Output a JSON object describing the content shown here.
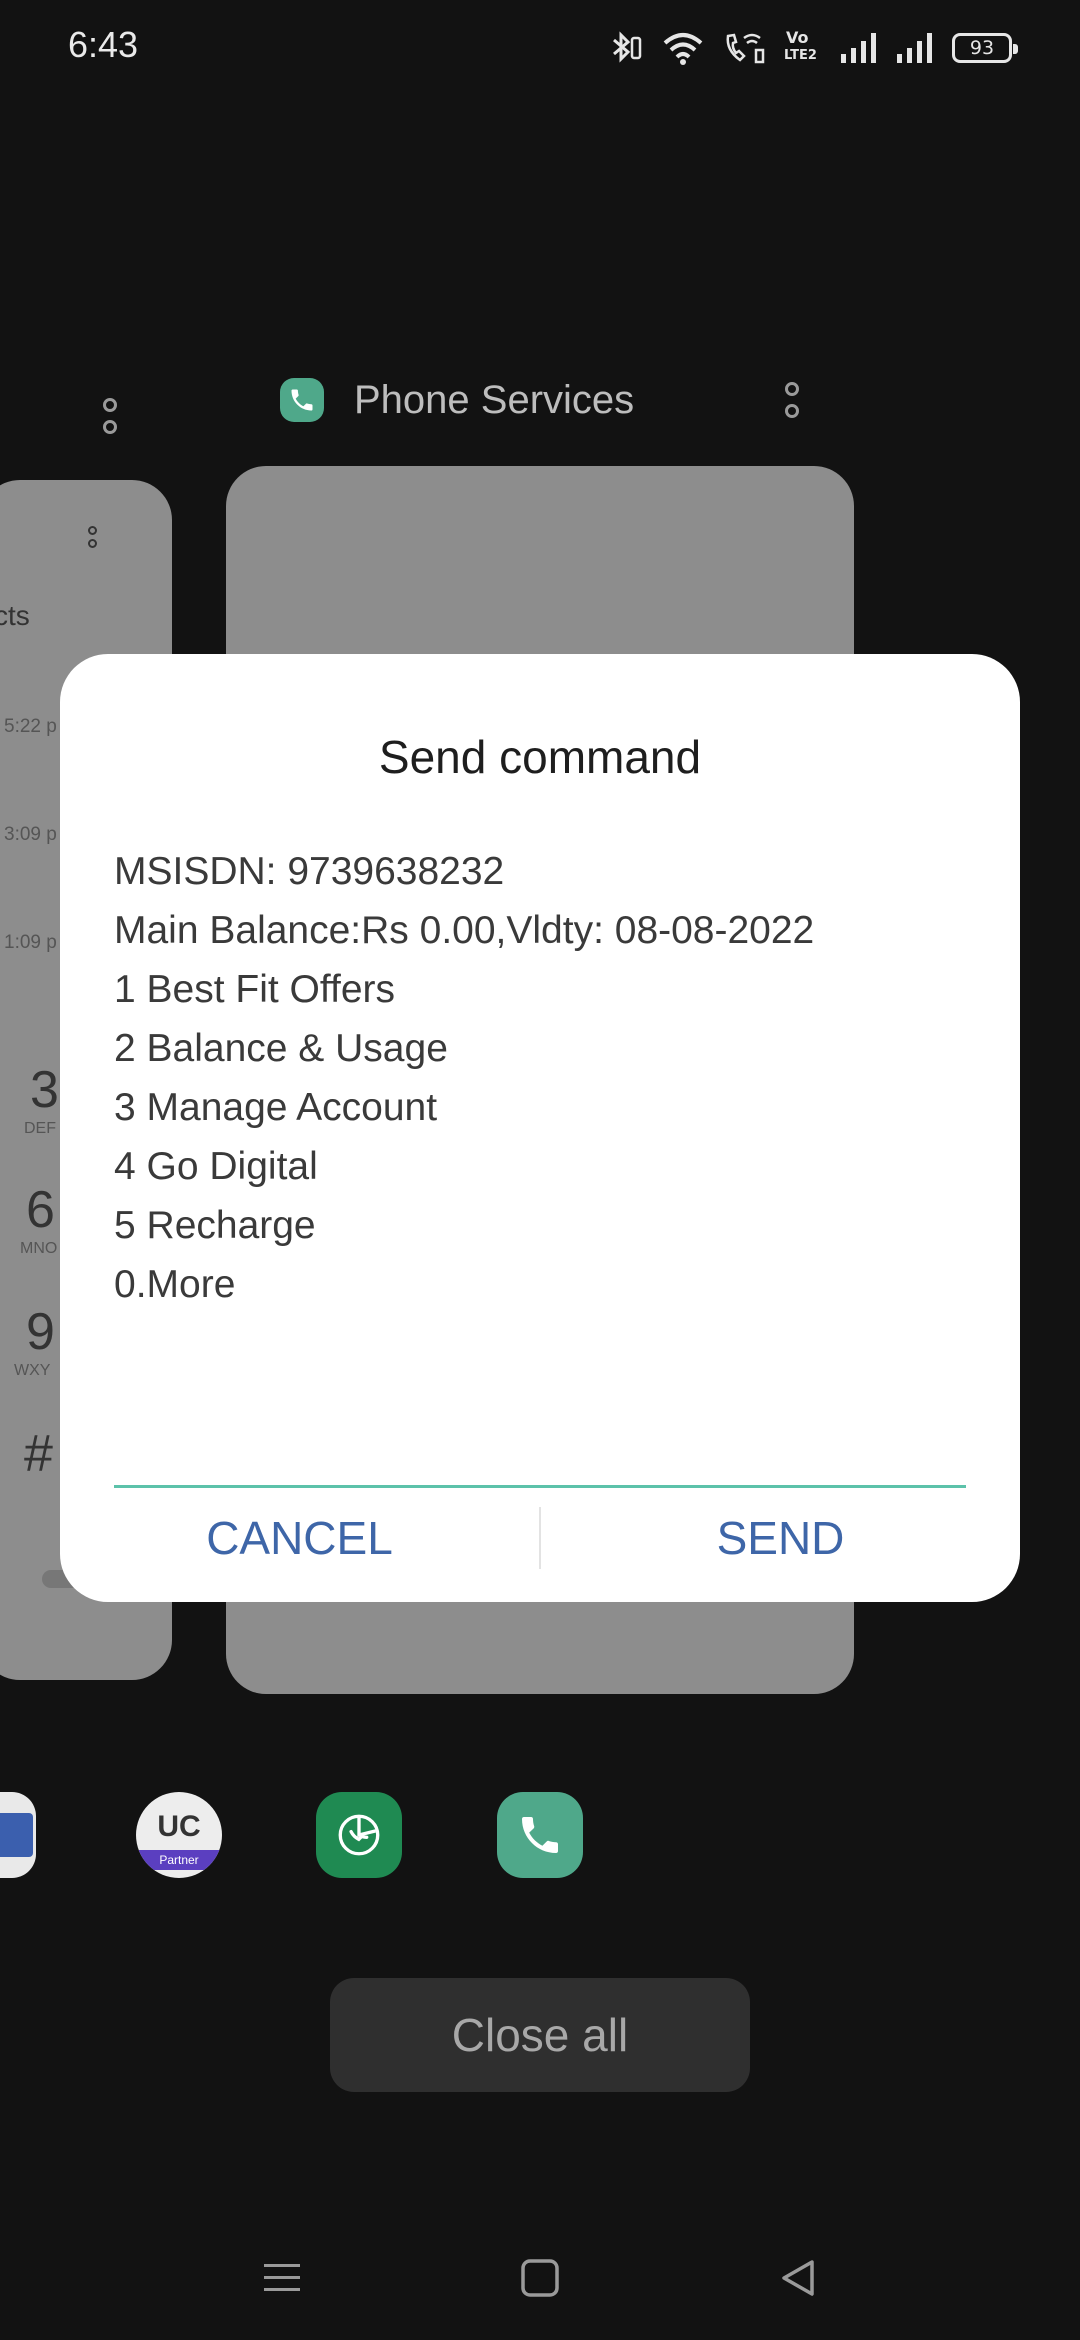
{
  "status_bar": {
    "time": "6:43",
    "battery": "93",
    "icons": [
      "bluetooth-icon",
      "wifi-icon",
      "wifi-calling-icon",
      "volte-icon",
      "signal-icon",
      "signal-icon"
    ],
    "volte_label_top": "Vo",
    "volte_label_bottom": "LTE2"
  },
  "recents": {
    "app_title": "Phone Services",
    "app_icon": "phone-icon",
    "left_card": {
      "partial_title": "cts",
      "times": [
        "5:22 p",
        "3:09 p",
        "1:09 p"
      ],
      "keys": [
        {
          "digit": "3",
          "letters": "DEF"
        },
        {
          "digit": "6",
          "letters": "MNO"
        },
        {
          "digit": "9",
          "letters": "WXY"
        },
        {
          "digit": "#",
          "letters": ""
        }
      ]
    }
  },
  "dialog": {
    "title": "Send command",
    "lines": [
      "MSISDN: 9739638232",
      "Main Balance:Rs 0.00,Vldty: 08-08-2022",
      "1 Best Fit Offers",
      "2 Balance & Usage",
      "3 Manage Account",
      "4 Go Digital",
      "5 Recharge",
      "0.More"
    ],
    "input_value": "",
    "cancel_label": "CANCEL",
    "send_label": "SEND"
  },
  "dock": {
    "uc_label": "UC",
    "uc_sub": "Partner"
  },
  "close_all_label": "Close all",
  "colors": {
    "accent_line": "#5cc2aa",
    "button_text": "#3e66a8",
    "app_green": "#4fa88a"
  }
}
